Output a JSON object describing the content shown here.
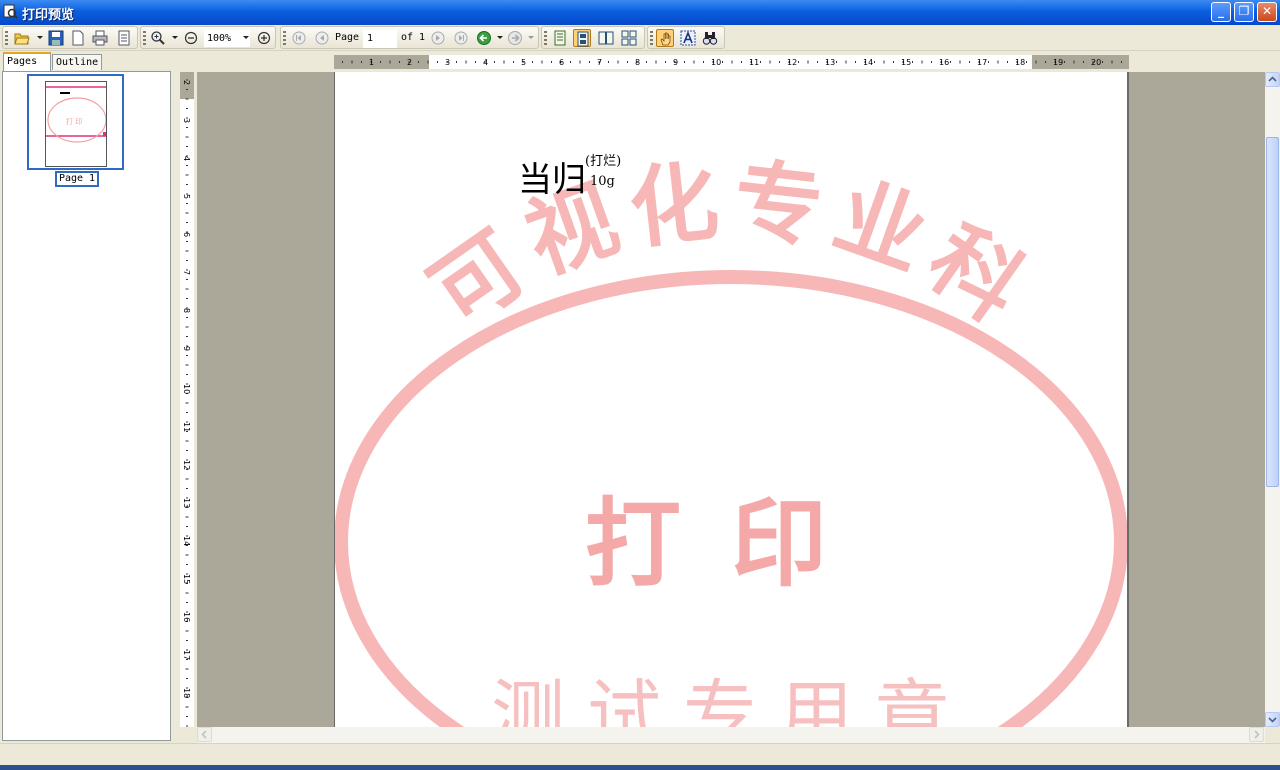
{
  "window": {
    "title": "打印预览",
    "minimize_glyph": "_",
    "maximize_glyph": "❐",
    "close_glyph": "✕"
  },
  "toolbar": {
    "zoom_value": "100%",
    "page_label": "Page",
    "page_value": "1",
    "page_of": "of 1",
    "icons": [
      "open-icon",
      "save-icon",
      "new-page-icon",
      "print-icon",
      "page-setup-icon",
      "zoom-in-icon",
      "zoom-out-icon",
      "zoom-plus-icon",
      "first-page-icon",
      "prev-page-icon",
      "next-page-icon",
      "last-page-icon",
      "back-icon",
      "forward-icon",
      "single-page-icon",
      "fit-page-icon",
      "two-pages-icon",
      "four-pages-icon",
      "hand-tool-icon",
      "text-select-icon",
      "find-icon"
    ]
  },
  "sidebar": {
    "tabs": [
      {
        "label": "Pages",
        "selected": true
      },
      {
        "label": "Outline",
        "selected": false
      }
    ],
    "thumbnails": [
      {
        "label": "Page 1"
      }
    ]
  },
  "ruler": {
    "horizontal": [
      "1",
      "2",
      "3",
      "4",
      "5",
      "6",
      "7",
      "8",
      "9",
      "10",
      "11",
      "12",
      "13",
      "14",
      "15",
      "16",
      "17",
      "18",
      "19",
      "20",
      "2"
    ],
    "vertical": [
      "2",
      "3",
      "4",
      "5",
      "6",
      "7",
      "8",
      "9",
      "10",
      "11",
      "12",
      "13",
      "14",
      "15",
      "16",
      "17",
      "18",
      "19"
    ]
  },
  "document": {
    "main_text": "当归",
    "superscript": "(打烂)",
    "subscript": "10g",
    "stamp": {
      "arc_text": "可视化专业科",
      "center_text": "打印",
      "bottom_text": "测试专用章",
      "color": "#f7b7b7"
    }
  },
  "colors": {
    "title_bar": "#0a5fe0",
    "selection": "#316ac5",
    "workspace": "#aca899"
  }
}
